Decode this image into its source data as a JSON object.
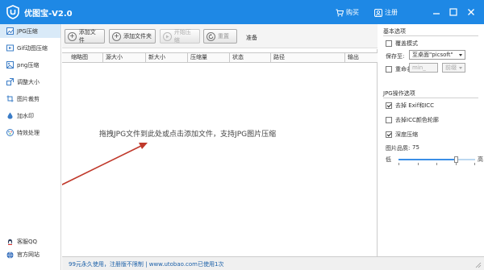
{
  "titlebar": {
    "title": "优图宝-V2.0",
    "buy_label": "购买",
    "register_label": "注册",
    "bg_color": "#1e88e5"
  },
  "sidebar": {
    "items": [
      {
        "label": "JPG压缩",
        "icon": "jpg-icon",
        "active": true
      },
      {
        "label": "Gif动图压缩",
        "icon": "gif-icon"
      },
      {
        "label": "png压缩",
        "icon": "png-icon"
      },
      {
        "label": "调整大小",
        "icon": "resize-icon"
      },
      {
        "label": "图片裁剪",
        "icon": "crop-icon"
      },
      {
        "label": "加水印",
        "icon": "watermark-icon"
      },
      {
        "label": "特效处理",
        "icon": "effects-icon"
      }
    ],
    "footer": [
      {
        "label": "客服QQ",
        "icon": "qq-icon"
      },
      {
        "label": "官方网站",
        "icon": "globe-icon"
      }
    ]
  },
  "toolbar": {
    "add_file": "添加文件",
    "add_folder": "添加文件夹",
    "start": "开始压缩",
    "reset": "重置",
    "status": "准备"
  },
  "table": {
    "columns": [
      "缩略图",
      "源大小",
      "新大小",
      "压缩量",
      "状态",
      "路径",
      "输出"
    ],
    "drop_hint": "拖拽JPG文件到此处或点击添加文件，支持JPG图片压缩"
  },
  "footer": {
    "text": "99元永久使用，注册版不限制 | www.utobao.com已使用1次"
  },
  "right_panel": {
    "basic_title": "基本选项",
    "overwrite_label": "覆盖模式",
    "overwrite_checked": false,
    "save_to_label": "保存至:",
    "save_to_value": "至桌面\"picsoft\"",
    "rename_label": "重命名",
    "rename_checked": false,
    "rename_placeholder": "min_",
    "rename_position": "前缀",
    "jpg_title": "JPG操作选项",
    "remove_exif_label": "去掉 Exif和ICC",
    "remove_exif_checked": true,
    "remove_icc_label": "去掉ICC颜色轮廓",
    "remove_icc_checked": false,
    "deep_compress_label": "深度压缩",
    "deep_compress_checked": true,
    "quality_label": "图片品质:",
    "quality_value": "75",
    "quality_fraction": 0.75,
    "low_label": "低",
    "high_label": "高",
    "arrow_color": "#c0392b"
  }
}
